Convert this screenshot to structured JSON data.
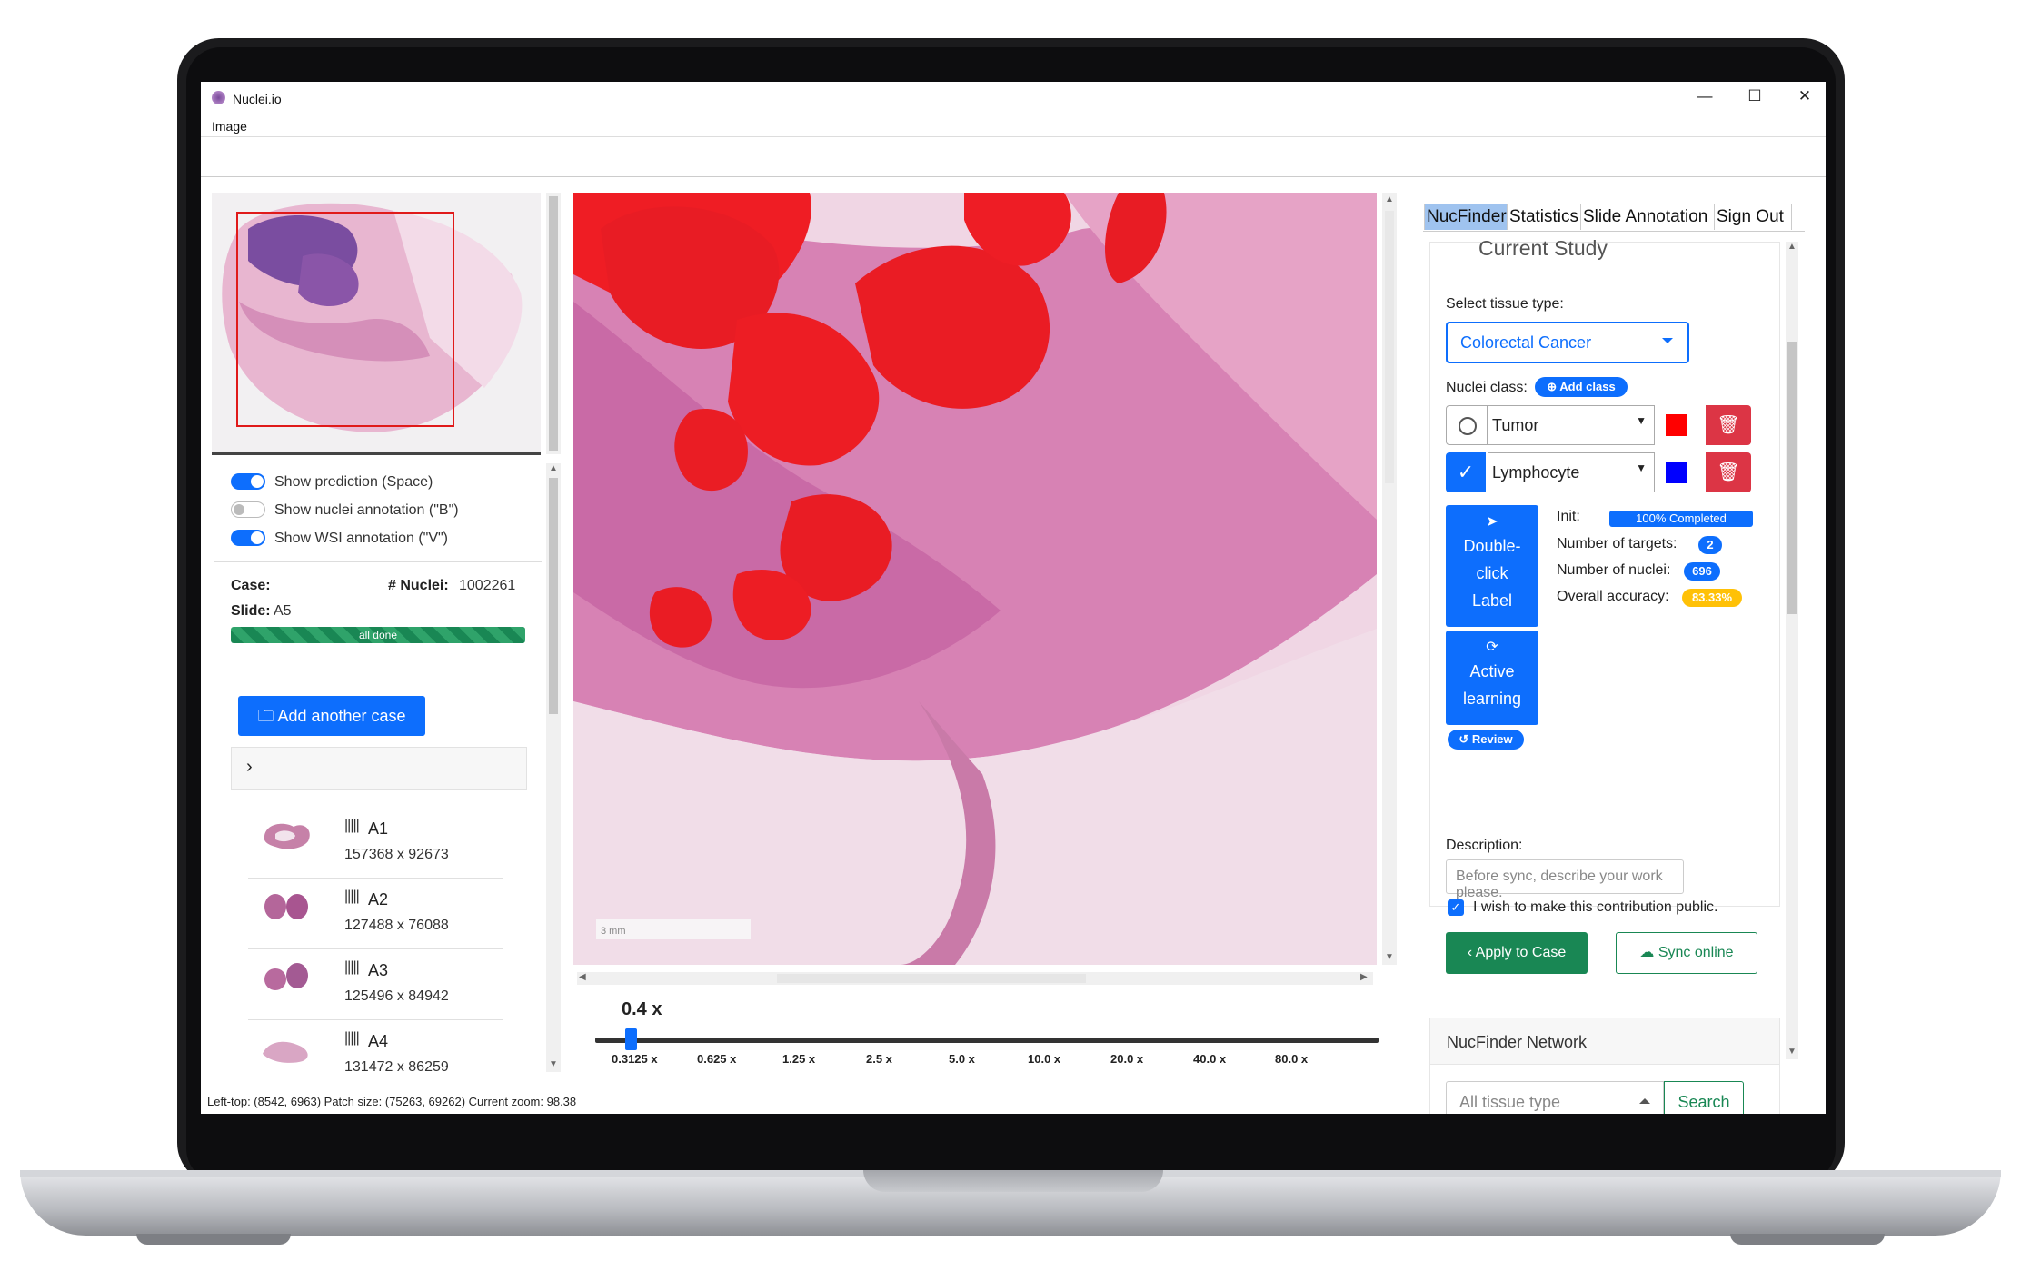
{
  "window": {
    "title": "Nuclei.io",
    "menu": [
      "Image"
    ],
    "controls": {
      "minimize": "—",
      "maximize": "☐",
      "close": "✕"
    }
  },
  "left": {
    "toggles": [
      {
        "label": "Show prediction (Space)",
        "on": true
      },
      {
        "label": "Show nuclei annotation (\"B\")",
        "on": false
      },
      {
        "label": "Show WSI annotation (\"V\")",
        "on": true
      }
    ],
    "case": {
      "case_label": "Case:",
      "nuclei_label": "# Nuclei:",
      "nuclei_value": "1002261",
      "slide_label": "Slide:",
      "slide_value": "A5",
      "progress": "all done",
      "progress_pct": 100
    },
    "add_case": "Add another case",
    "chevron": "›",
    "slides": [
      {
        "name": "A1",
        "size": "157368 x 92673"
      },
      {
        "name": "A2",
        "size": "127488 x 76088"
      },
      {
        "name": "A3",
        "size": "125496 x 84942"
      },
      {
        "name": "A4",
        "size": "131472 x 86259"
      }
    ]
  },
  "viewer": {
    "zoom": "0.4 x",
    "ticks": [
      "0.3125 x",
      "0.625 x",
      "1.25 x",
      "2.5 x",
      "5.0 x",
      "10.0 x",
      "20.0 x",
      "40.0 x",
      "80.0 x"
    ],
    "scale_bar": "3 mm",
    "status": "Left-top: (8542, 6963) Patch size: (75263, 69262) Current zoom: 98.38"
  },
  "right": {
    "tabs": [
      "NucFinder",
      "Statistics",
      "Slide Annotation",
      "Sign Out"
    ],
    "study_title": "Current Study",
    "tissue_label": "Select tissue type:",
    "tissue_value": "Colorectal Cancer",
    "nuclei_class_label": "Nuclei class:",
    "add_class": "Add class",
    "classes": [
      {
        "name": "Tumor",
        "color": "#ff0000",
        "selected": false
      },
      {
        "name": "Lymphocyte",
        "color": "#0000ff",
        "selected": true
      }
    ],
    "double_click": {
      "line1": "Double-",
      "line2": "click",
      "line3": "Label"
    },
    "active_learning": {
      "line1": "Active",
      "line2": "learning"
    },
    "review": "Review",
    "stats": {
      "init_label": "Init:",
      "init_value": "100% Completed",
      "targets_label": "Number of targets:",
      "targets_value": "2",
      "nuclei_label": "Number of nuclei:",
      "nuclei_value": "696",
      "accuracy_label": "Overall accuracy:",
      "accuracy_value": "83.33%"
    },
    "description_label": "Description:",
    "description_placeholder": "Before sync, describe your work please.",
    "public_label": "I wish to make this contribution public.",
    "apply": "Apply to Case",
    "sync": "Sync online",
    "network_title": "NucFinder Network",
    "network_select": "All tissue type",
    "search": "Search"
  },
  "colors": {
    "primary": "#0d6efd",
    "success": "#198754",
    "danger": "#dc3545",
    "warning": "#ffc107",
    "tab_active": "#9fc3ef"
  }
}
